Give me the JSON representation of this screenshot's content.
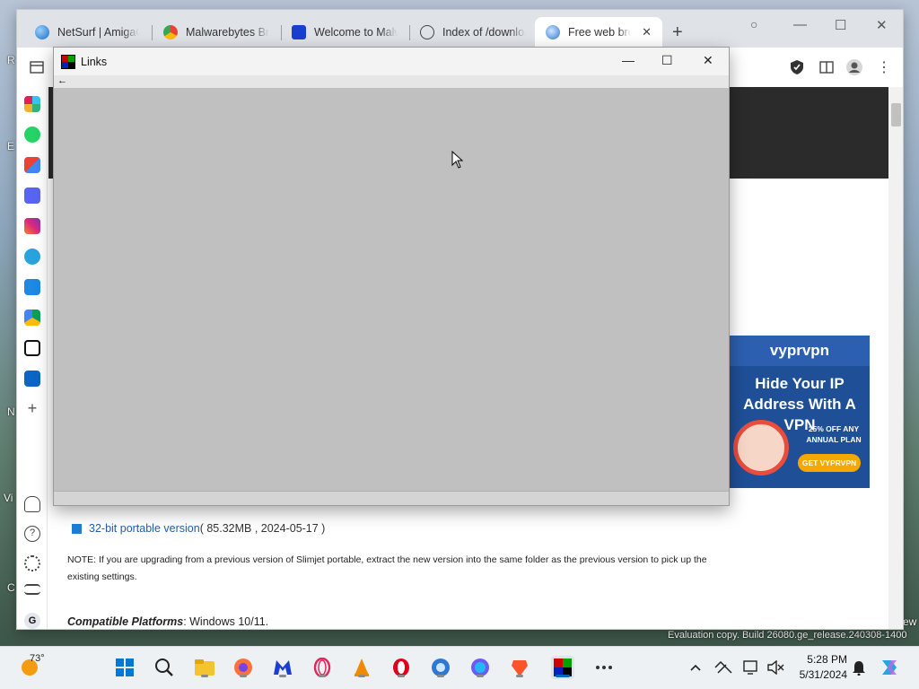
{
  "browser": {
    "tabs": [
      {
        "label": "NetSurf | AmigaOS",
        "icon": "globe-blue-icon",
        "active": false
      },
      {
        "label": "Malwarebytes Browser Guard",
        "icon": "chrome-store-icon",
        "active": false
      },
      {
        "label": "Welcome to Malwarebytes",
        "icon": "malwarebytes-icon",
        "active": false
      },
      {
        "label": "Index of /downloads",
        "icon": "globe-icon",
        "active": false
      },
      {
        "label": "Free web browser",
        "icon": "slimjet-icon",
        "active": true
      }
    ],
    "new_tab_symbol": "+",
    "window_controls": {
      "minimize": "—",
      "maximize": "☐",
      "close": "✕"
    }
  },
  "links_window": {
    "title": "Links",
    "back_arrow": "←",
    "controls": {
      "minimize": "—",
      "maximize": "☐",
      "close": "✕"
    }
  },
  "page": {
    "download_link_text": "32-bit portable version",
    "download_meta": " ( 85.32MB , 2024-05-17 )",
    "note": "NOTE: If you are upgrading from a previous version of Slimjet portable, extract the new version into the same folder as the previous version to pick up the existing settings.",
    "compat_label": "Compatible Platforms",
    "compat_value": ": Windows 10/11."
  },
  "ad": {
    "brand": "vyprvpn",
    "headline": "Hide Your IP Address With A VPN",
    "offer": "25% OFF ANY ANNUAL PLAN",
    "button": "GET VYPRVPN"
  },
  "taskbar": {
    "temperature": "73°",
    "time": "5:28 PM",
    "date": "5/31/2024"
  },
  "desktop": {
    "eval_watermark": "Evaluation copy. Build 26080.ge_release.240308-1400"
  },
  "colors": {
    "accent": "#1f5fa9",
    "links_bg": "#c0c0c0",
    "ad_bg": "#1f4f97"
  }
}
